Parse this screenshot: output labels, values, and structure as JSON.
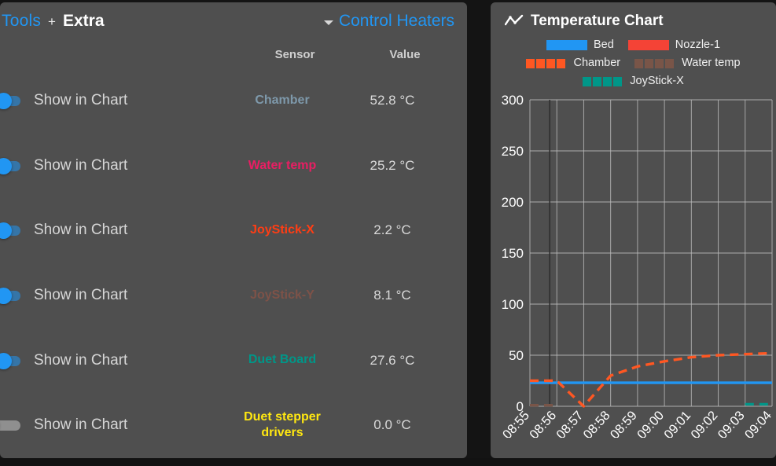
{
  "header": {
    "tools_label": "Tools",
    "plus": "+",
    "extra_label": "Extra",
    "control_heaters_label": "Control Heaters",
    "caret_icon": "chevron-down-icon",
    "accent_blue": "#2196f3"
  },
  "table": {
    "columns": [
      "",
      "Sensor",
      "Value"
    ],
    "sensor_header": "Sensor",
    "value_header": "Value",
    "rows": [
      {
        "toggle_label": "Show in Chart",
        "toggle_on": true,
        "sensor": "Chamber",
        "sensor_color": "#7e99ab",
        "value": "52.8 °C"
      },
      {
        "toggle_label": "Show in Chart",
        "toggle_on": true,
        "sensor": "Water temp",
        "sensor_color": "#e91e63",
        "value": "25.2 °C"
      },
      {
        "toggle_label": "Show in Chart",
        "toggle_on": true,
        "sensor": "JoyStick-X",
        "sensor_color": "#ff3d14",
        "value": "2.2 °C"
      },
      {
        "toggle_label": "Show in Chart",
        "toggle_on": true,
        "sensor": "JoyStick-Y",
        "sensor_color": "#7d5248",
        "value": "8.1 °C"
      },
      {
        "toggle_label": "Show in Chart",
        "toggle_on": true,
        "sensor": "Duet Board",
        "sensor_color": "#009688",
        "value": "27.6 °C"
      },
      {
        "toggle_label": "Show in Chart",
        "toggle_on": false,
        "sensor": "Duet stepper drivers",
        "sensor_color": "#ffe711",
        "value": "0.0 °C"
      }
    ]
  },
  "chart_panel": {
    "title": "Temperature Chart",
    "title_icon": "line-chart-icon"
  },
  "chart_data": {
    "type": "line",
    "title": "Temperature Chart",
    "xlabel": "",
    "ylabel": "",
    "ylim": [
      0,
      300
    ],
    "yticks": [
      0,
      50,
      100,
      150,
      200,
      250,
      300
    ],
    "grid": true,
    "legend_position": "top",
    "x": [
      "08:55",
      "08:56",
      "08:57",
      "08:58",
      "08:59",
      "09:00",
      "09:01",
      "09:02",
      "09:03",
      "09:04"
    ],
    "series": [
      {
        "name": "Bed",
        "color": "#2196f3",
        "style": "solid",
        "values": [
          23,
          23,
          23,
          23,
          23,
          23,
          23,
          23,
          23,
          23
        ]
      },
      {
        "name": "Nozzle-1",
        "color": "#f44336",
        "style": "solid",
        "values": [
          null,
          null,
          null,
          null,
          null,
          null,
          null,
          null,
          null,
          null
        ]
      },
      {
        "name": "Chamber",
        "color": "#ff5722",
        "style": "dashed",
        "values": [
          25,
          25,
          0,
          30,
          39,
          44,
          48,
          50,
          51,
          52
        ]
      },
      {
        "name": "Water temp",
        "color": "#795548",
        "style": "dashed",
        "values": [
          1,
          1,
          null,
          null,
          null,
          null,
          null,
          null,
          null,
          null
        ]
      },
      {
        "name": "JoyStick-X",
        "color": "#009688",
        "style": "dashed",
        "values": [
          null,
          null,
          null,
          null,
          null,
          null,
          null,
          null,
          2,
          2
        ]
      }
    ]
  }
}
